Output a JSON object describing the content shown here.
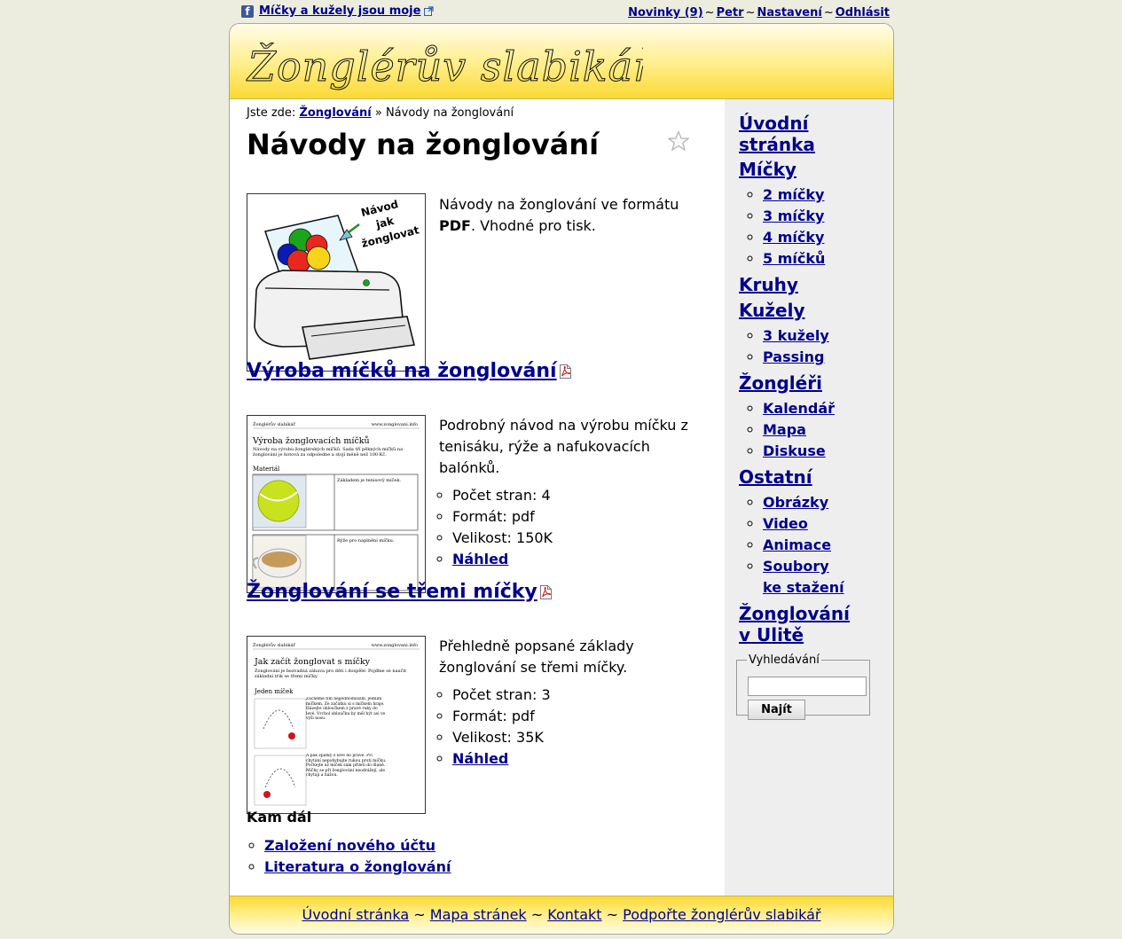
{
  "topbar": {
    "fb_label": "Míčky a kužely jsou moje",
    "links": [
      "Novinky (9)",
      "Petr",
      "Nastavení",
      "Odhlásit"
    ],
    "separator": "~"
  },
  "site": {
    "logo_text": "Žonglérův slabikář"
  },
  "breadcrumb": {
    "prefix": "Jste zde:",
    "home": "Žonglování",
    "sep": "»",
    "current": "Návody na žonglování"
  },
  "page": {
    "title": "Návody na žonglování",
    "intro_before": "Návody na žonglování ve formátu ",
    "intro_bold": "PDF",
    "intro_after": ". Vhodné pro tisk."
  },
  "printer_image_text": [
    "Návod",
    "jak",
    "žonglovat"
  ],
  "documents": [
    {
      "title": "Výroba míčků na žonglování",
      "description": "Podrobný návod na výrobu míčku z tenisáku, rýže a nafukovacích balónků.",
      "pages": "Počet stran: 4",
      "format": "Formát: pdf",
      "size": "Velikost: 150K",
      "preview": "Náhled",
      "thumb": {
        "header_left": "Žonglérův slabikář",
        "header_right": "www.zonglovani.info",
        "heading": "Výroba žonglovacích míčků",
        "body": "Návody na výrobu žonglérských míčků. Sada tří pěkných míčků na žonglování je hotová za odpoledne a stojí méně než 100 Kč.",
        "subheading": "Materiál",
        "row1_text": "Základem je tenisový míček.",
        "row2_text": "Rýže pro naplnění míčku."
      }
    },
    {
      "title": "Žonglování se třemi míčky",
      "description": "Přehledně popsané základy žonglování se třemi míčky.",
      "pages": "Počet stran: 3",
      "format": "Formát: pdf",
      "size": "Velikost: 35K",
      "preview": "Náhled",
      "thumb": {
        "header_left": "Žonglérův slabikář",
        "header_right": "www.zonglovani.info",
        "heading": "Jak začít žonglovat s míčky",
        "body": "Žonglování je bezvadná zábava pro děti i dospělé. Pojďme se naučit základní trik se třemi míčky.",
        "subheading": "Jeden míček",
        "row1_text": "Začneme tím nejjednodušším, jedním míčkem. Ze začátku si s míčkem hraje. Házejte obloučkem z pravé ruky do levé. Vrchol obloučku by měl být asi ve výši nosu.",
        "row2_text": "A pak zpátky z levé do pravé. Při chytání nepohybujte rukou proti míčku. Počkejte až míček sám přiletí do dlaně. Míčky se při žonglování neodrážejí, ale chytají a hážou."
      }
    }
  ],
  "kam_dal": {
    "heading": "Kam dál",
    "links": [
      "Založení nového účtu",
      "Literatura o žonglování"
    ]
  },
  "sidebar": {
    "home_lines": [
      "Úvodní",
      "stránka"
    ],
    "balls": "Míčky",
    "balls_items": [
      "2 míčky",
      "3 míčky",
      "4 míčky",
      "5 míčků"
    ],
    "rings": "Kruhy",
    "clubs": "Kužely",
    "clubs_items": [
      "3 kužely",
      "Passing"
    ],
    "jugglers": "Žongléři",
    "jugglers_items": [
      "Kalendář",
      "Mapa",
      "Diskuse"
    ],
    "other": "Ostatní",
    "other_items": [
      "Obrázky",
      "Video",
      "Animace"
    ],
    "downloads_lines": [
      "Soubory",
      "ke stažení"
    ],
    "ulita_lines": [
      "Žonglování",
      "v Ulitě"
    ],
    "search_legend": "Vyhledávání",
    "search_button": "Najít"
  },
  "footer": {
    "links": [
      "Úvodní stránka",
      "Mapa stránek",
      "Kontakt",
      "Podpořte žonglérův slabikář"
    ],
    "separator": "~"
  },
  "colors": {
    "link": "#00008b",
    "page_bg": "#ecedde",
    "header_yellow": "#fbd933",
    "sidebar_bg": "#eeeeee"
  }
}
